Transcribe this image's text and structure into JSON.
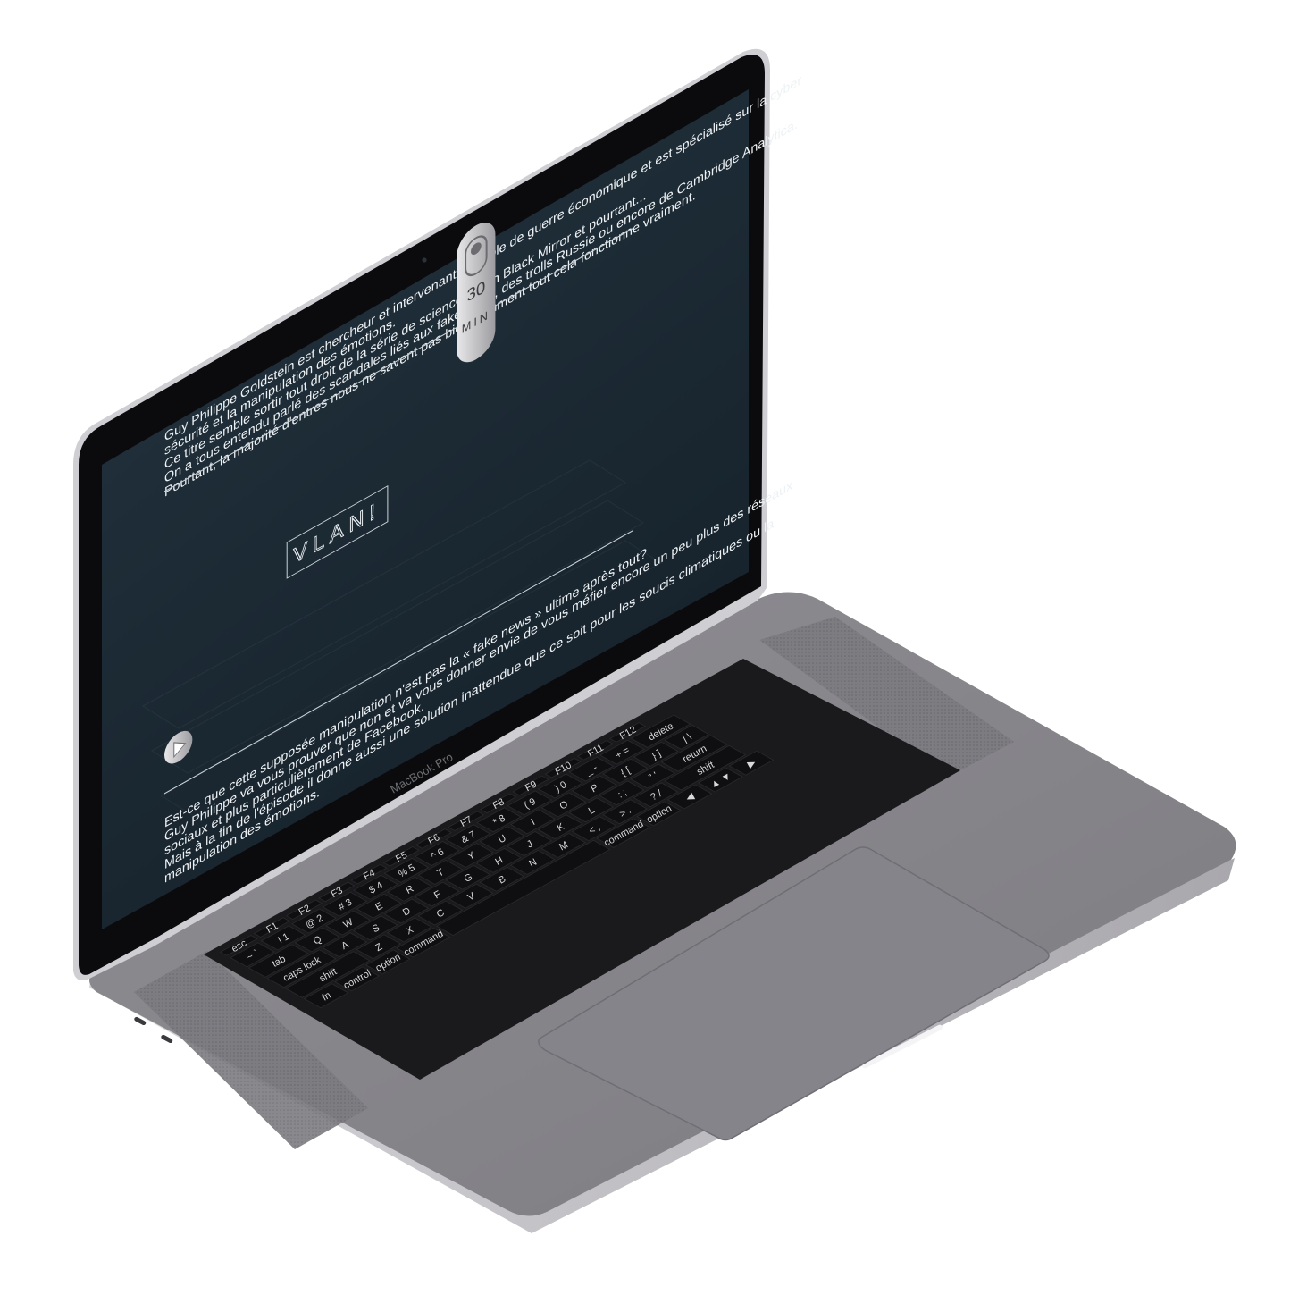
{
  "device": {
    "name": "MacBook Pro",
    "brand_label": "MacBook Pro"
  },
  "screen": {
    "background": "#1c2932",
    "intro_paragraph": [
      "Guy Philippe Goldstein est chercheur et intervenant à l'école de guerre économique  et est spécialisé sur la cyber",
      "sécurité et la manipulation des émotions.",
      "Ce titre semble sortir tout droit de la série de science fiction Black Mirror et pourtant...",
      "On a tous entendu parlé des scandales liés aux fake news, des trolls Russie ou encore de Cambridge Analytica.",
      "Pourtant, la majorité d'entres nous ne savent pas bien comment tout cela fonctionne vraiment."
    ],
    "logo_text": "VLAN!",
    "duration": {
      "number": "30",
      "unit": "MIN"
    },
    "outro_paragraph": [
      "Est-ce que cette supposée manipulation n'est pas la « fake news » ultime après tout?",
      "Guy Philippe va vous prouver que non et va vous donner envie de vous méfier encore un peu plus des réseaux",
      "sociaux et plus particulièrement de Facebook.",
      "Mais à la fin de l'épisode il donne aussi une solution inattendue que ce soit pour les soucis climatiques ou la",
      "manipulation des émotions."
    ],
    "play_icon": "play-icon",
    "toggle_icon": "toggle-switch-icon"
  },
  "keyboard": {
    "touch_bar": [
      "esc",
      "F1",
      "F2",
      "F3",
      "F4",
      "F5",
      "F6",
      "F7",
      "F8",
      "F9",
      "F10",
      "F11",
      "F12"
    ],
    "number_row": [
      {
        "top": "~",
        "bottom": "`"
      },
      {
        "top": "!",
        "bottom": "1"
      },
      {
        "top": "@",
        "bottom": "2"
      },
      {
        "top": "#",
        "bottom": "3"
      },
      {
        "top": "$",
        "bottom": "4"
      },
      {
        "top": "%",
        "bottom": "5"
      },
      {
        "top": "^",
        "bottom": "6"
      },
      {
        "top": "&",
        "bottom": "7"
      },
      {
        "top": "*",
        "bottom": "8"
      },
      {
        "top": "(",
        "bottom": "9"
      },
      {
        "top": ")",
        "bottom": "0"
      },
      {
        "top": "_",
        "bottom": "-"
      },
      {
        "top": "+",
        "bottom": "="
      },
      {
        "top": "",
        "bottom": "delete"
      }
    ],
    "qwerty_row": [
      "tab",
      "Q",
      "W",
      "E",
      "R",
      "T",
      "Y",
      "U",
      "I",
      "O",
      "P",
      "{ [",
      "} ]",
      "| \\"
    ],
    "home_row": [
      "caps lock",
      "A",
      "S",
      "D",
      "F",
      "G",
      "H",
      "J",
      "K",
      "L",
      ": ;",
      "\" '",
      "return"
    ],
    "shift_row": [
      "shift",
      "Z",
      "X",
      "C",
      "V",
      "B",
      "N",
      "M",
      "< ,",
      "> .",
      "? /",
      "shift"
    ],
    "bottom_row": [
      "fn",
      "control",
      "option",
      "command",
      "",
      "command",
      "option",
      "◀",
      "▲ ▼",
      "▶"
    ]
  },
  "colors": {
    "chassis": "#8d8c91",
    "chassis_light": "#bfbec3",
    "bezel": "#0c0c0e",
    "keys": "#101012",
    "screen": "#1c2932"
  }
}
